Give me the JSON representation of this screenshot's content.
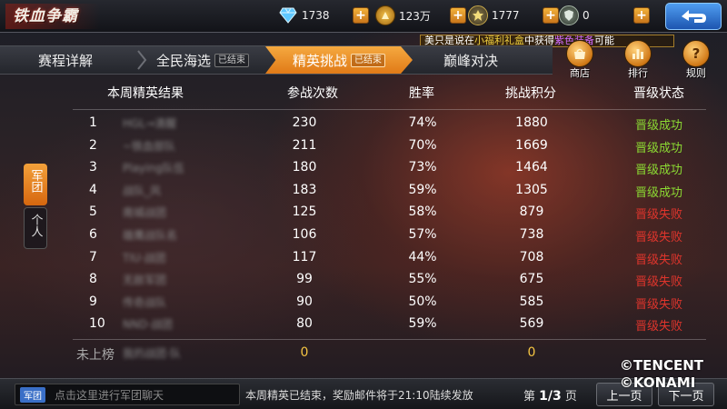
{
  "game_title": "铁血争霸",
  "currencies": [
    {
      "icon": "diamond-icon",
      "value": "1738"
    },
    {
      "icon": "gold-coin-icon",
      "value": "123万"
    },
    {
      "icon": "honor-badge-icon",
      "value": "1777"
    },
    {
      "icon": "shield-medal-icon",
      "value": "0"
    }
  ],
  "ticker": {
    "part1": "美只是说在",
    "part2": "小福利礼盒",
    "part3": "中获得",
    "part4": "紫色装备",
    "part5": "可能"
  },
  "tabs": [
    {
      "label": "赛程详解",
      "badge": ""
    },
    {
      "label": "全民海选",
      "badge": "已结束"
    },
    {
      "label": "精英挑战",
      "badge": "已结束"
    },
    {
      "label": "巅峰对决",
      "badge": ""
    }
  ],
  "side_buttons": [
    {
      "label": "商店",
      "icon": "shop-icon"
    },
    {
      "label": "排行",
      "icon": "ranking-icon"
    },
    {
      "label": "规则",
      "icon": "rules-icon"
    }
  ],
  "side_tabs": {
    "active": "军团",
    "inactive": "个人"
  },
  "table": {
    "headers": [
      "本周精英结果",
      "参战次数",
      "胜率",
      "挑战积分",
      "晋级状态"
    ],
    "rows": [
      {
        "rank": "1",
        "name": "HGL→清醒",
        "entries": "230",
        "win_rate": "74%",
        "score": "1880",
        "status": "晋级成功",
        "ok": true
      },
      {
        "rank": "2",
        "name": "~铁血部队",
        "entries": "211",
        "win_rate": "70%",
        "score": "1669",
        "status": "晋级成功",
        "ok": true
      },
      {
        "rank": "3",
        "name": "Playing队伍",
        "entries": "180",
        "win_rate": "73%",
        "score": "1464",
        "status": "晋级成功",
        "ok": true
      },
      {
        "rank": "4",
        "name": "战队_风",
        "entries": "183",
        "win_rate": "59%",
        "score": "1305",
        "status": "晋级成功",
        "ok": true
      },
      {
        "rank": "5",
        "name": "南城战团",
        "entries": "125",
        "win_rate": "58%",
        "score": "879",
        "status": "晋级失败",
        "ok": false
      },
      {
        "rank": "6",
        "name": "雄鹰战队名",
        "entries": "106",
        "win_rate": "57%",
        "score": "738",
        "status": "晋级失败",
        "ok": false
      },
      {
        "rank": "7",
        "name": "TIU·战团",
        "entries": "117",
        "win_rate": "44%",
        "score": "708",
        "status": "晋级失败",
        "ok": false
      },
      {
        "rank": "8",
        "name": "无敌军团",
        "entries": "99",
        "win_rate": "55%",
        "score": "675",
        "status": "晋级失败",
        "ok": false
      },
      {
        "rank": "9",
        "name": "传奇战队",
        "entries": "90",
        "win_rate": "50%",
        "score": "585",
        "status": "晋级失败",
        "ok": false
      },
      {
        "rank": "10",
        "name": "NND·战团",
        "entries": "80",
        "win_rate": "59%",
        "score": "569",
        "status": "晋级失败",
        "ok": false
      }
    ],
    "unranked": {
      "label": "未上榜",
      "name": "我的战团·队",
      "entries": "0",
      "score": "0"
    }
  },
  "bottom": {
    "chat_tag": "军团",
    "chat_placeholder": "点击这里进行军团聊天",
    "notice": "本周精英已结束，奖励邮件将于21:10陆续发放",
    "page_prefix": "第",
    "page_value": "1/3",
    "page_suffix": "页",
    "prev_label": "上一页",
    "next_label": "下一页"
  },
  "watermark": {
    "line1": "©TENCENT",
    "line2": "©KONAMI"
  },
  "colors": {
    "accent": "#e98a1f",
    "success": "#8cdb33",
    "fail": "#e0352c",
    "gold": "#f5c542"
  }
}
